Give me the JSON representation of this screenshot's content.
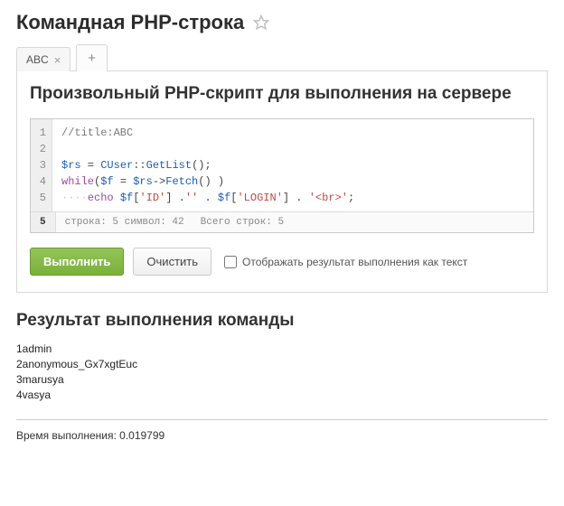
{
  "header": {
    "title": "Командная PHP-строка"
  },
  "tabs": {
    "items": [
      {
        "label": "ABC"
      }
    ],
    "add_label": "+"
  },
  "panel": {
    "title": "Произвольный PHP-скрипт для выполнения на сервере"
  },
  "editor": {
    "line_numbers": [
      "1",
      "2",
      "3",
      "4",
      "5"
    ],
    "code": {
      "l1_comment": "//title:ABC",
      "l3_var1": "$rs",
      "l3_eq": " = ",
      "l3_class": "CUser",
      "l3_sep": "::",
      "l3_method": "GetList",
      "l3_tail": "();",
      "l4_while": "while",
      "l4_open": "(",
      "l4_varf": "$f",
      "l4_eq": " = ",
      "l4_varrs": "$rs",
      "l4_arrow": "->",
      "l4_fetch": "Fetch",
      "l4_tail": "() )",
      "l5_invis": "····",
      "l5_echo": "echo",
      "l5_sp1": " ",
      "l5_varf": "$f",
      "l5_b1o": "[",
      "l5_str1": "'ID'",
      "l5_b1c": "] .",
      "l5_str2": "''",
      "l5_dot2": " . ",
      "l5_varf2": "$f",
      "l5_b2o": "[",
      "l5_str3": "'LOGIN'",
      "l5_b2c": "] . ",
      "l5_str4": "'<br>'",
      "l5_semi": ";"
    },
    "status": {
      "current_line": "5",
      "pos": "строка: 5   символ: 42",
      "total": "Всего строк: 5"
    }
  },
  "actions": {
    "execute": "Выполнить",
    "clear": "Очистить",
    "checkbox_label": "Отображать результат выполнения как текст"
  },
  "result": {
    "title": "Результат выполнения команды",
    "lines": [
      "1admin",
      "2anonymous_Gx7xgtEuc",
      "3marusya",
      "4vasya"
    ]
  },
  "exec_time": {
    "label": "Время выполнения: ",
    "value": "0.019799"
  }
}
